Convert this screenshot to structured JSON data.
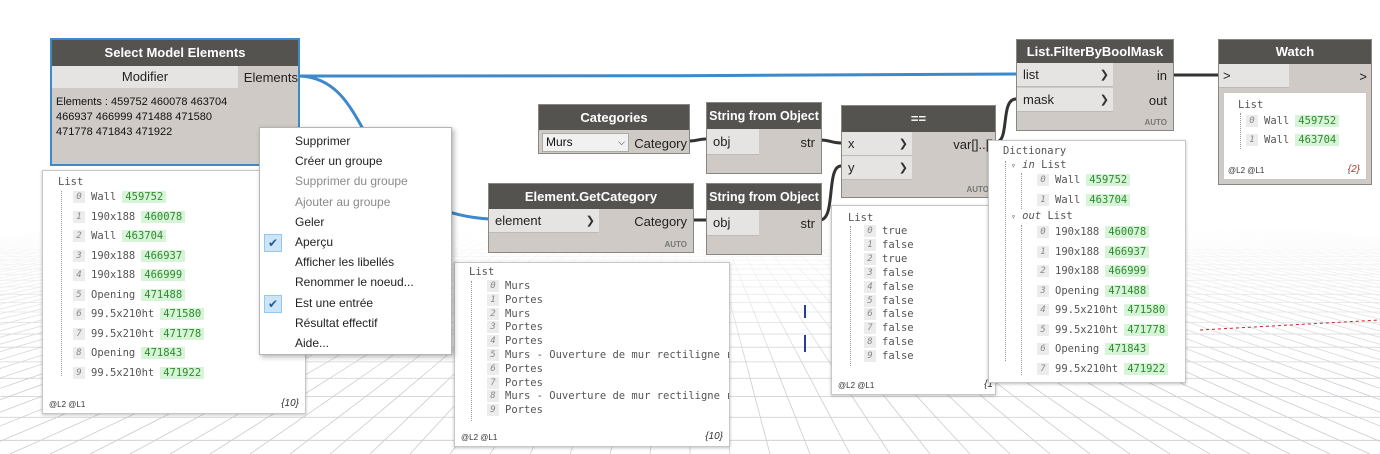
{
  "nodes": {
    "select": {
      "title": "Select Model Elements",
      "button": "Modifier",
      "out_port": "Elements",
      "info": [
        "Elements : 459752 460078 463704",
        "466937 466999 471488 471580",
        "471778 471843 471922"
      ]
    },
    "categories": {
      "title": "Categories",
      "dropdown_value": "Murs",
      "out_port": "Category"
    },
    "str1": {
      "title": "String from Object",
      "in_port": "obj",
      "out_port": "str"
    },
    "str2": {
      "title": "String from Object",
      "in_port": "obj",
      "out_port": "str"
    },
    "getcat": {
      "title": "Element.GetCategory",
      "in_port": "element",
      "out_port": "Category",
      "auto": "AUTO"
    },
    "eq": {
      "title": "==",
      "in_x": "x",
      "in_y": "y",
      "out_port": "var[]..[]",
      "auto": "AUTO"
    },
    "filter": {
      "title": "List.FilterByBoolMask",
      "in_list": "list",
      "in_mask": "mask",
      "out_in": "in",
      "out_out": "out",
      "auto": "AUTO"
    },
    "watch": {
      "title": "Watch",
      "in_port": ">",
      "out_port": ">"
    }
  },
  "previews": {
    "p1": {
      "header": "List",
      "items": [
        {
          "i": "0",
          "t": "Wall",
          "g": "459752"
        },
        {
          "i": "1",
          "t": "190x188",
          "g": "460078"
        },
        {
          "i": "2",
          "t": "Wall",
          "g": "463704"
        },
        {
          "i": "3",
          "t": "190x188",
          "g": "466937"
        },
        {
          "i": "4",
          "t": "190x188",
          "g": "466999"
        },
        {
          "i": "5",
          "t": "Opening",
          "g": "471488"
        },
        {
          "i": "6",
          "t": "99.5x210ht",
          "g": "471580"
        },
        {
          "i": "7",
          "t": "99.5x210ht",
          "g": "471778"
        },
        {
          "i": "8",
          "t": "Opening",
          "g": "471843"
        },
        {
          "i": "9",
          "t": "99.5x210ht",
          "g": "471922"
        }
      ],
      "levels": "@L2 @L1",
      "count": "{10}"
    },
    "p2": {
      "header": "List",
      "items": [
        {
          "i": "0",
          "t": "Murs"
        },
        {
          "i": "1",
          "t": "Portes"
        },
        {
          "i": "2",
          "t": "Murs"
        },
        {
          "i": "3",
          "t": "Portes"
        },
        {
          "i": "4",
          "t": "Portes"
        },
        {
          "i": "5",
          "t": "Murs - Ouverture de mur rectiligne re"
        },
        {
          "i": "6",
          "t": "Portes"
        },
        {
          "i": "7",
          "t": "Portes"
        },
        {
          "i": "8",
          "t": "Murs - Ouverture de mur rectiligne re"
        },
        {
          "i": "9",
          "t": "Portes"
        }
      ],
      "levels": "@L2 @L1",
      "count": "{10}"
    },
    "p3": {
      "header": "List",
      "items": [
        {
          "i": "0",
          "t": "true"
        },
        {
          "i": "1",
          "t": "false"
        },
        {
          "i": "2",
          "t": "true"
        },
        {
          "i": "3",
          "t": "false"
        },
        {
          "i": "4",
          "t": "false"
        },
        {
          "i": "5",
          "t": "false"
        },
        {
          "i": "6",
          "t": "false"
        },
        {
          "i": "7",
          "t": "false"
        },
        {
          "i": "8",
          "t": "false"
        },
        {
          "i": "9",
          "t": "false"
        }
      ],
      "levels": "@L2 @L1",
      "count": "{1"
    },
    "p4": {
      "header": "Dictionary",
      "in_label": "in",
      "in_list": "List",
      "out_label": "out",
      "out_list": "List",
      "in_items": [
        {
          "i": "0",
          "t": "Wall",
          "g": "459752"
        },
        {
          "i": "1",
          "t": "Wall",
          "g": "463704"
        }
      ],
      "out_items": [
        {
          "i": "0",
          "t": "190x188",
          "g": "460078"
        },
        {
          "i": "1",
          "t": "190x188",
          "g": "466937"
        },
        {
          "i": "2",
          "t": "190x188",
          "g": "466999"
        },
        {
          "i": "3",
          "t": "Opening",
          "g": "471488"
        },
        {
          "i": "4",
          "t": "99.5x210ht",
          "g": "471580"
        },
        {
          "i": "5",
          "t": "99.5x210ht",
          "g": "471778"
        },
        {
          "i": "6",
          "t": "Opening",
          "g": "471843"
        },
        {
          "i": "7",
          "t": "99.5x210ht",
          "g": "471922"
        }
      ]
    },
    "p5": {
      "header": "List",
      "items": [
        {
          "i": "0",
          "t": "Wall",
          "g": "459752"
        },
        {
          "i": "1",
          "t": "Wall",
          "g": "463704"
        }
      ],
      "levels": "@L2 @L1",
      "count": "{2}"
    }
  },
  "context_menu": [
    {
      "label": "Supprimer",
      "state": "normal"
    },
    {
      "label": "Créer un groupe",
      "state": "normal"
    },
    {
      "label": "Supprimer du groupe",
      "state": "disabled"
    },
    {
      "label": "Ajouter au groupe",
      "state": "disabled"
    },
    {
      "label": "Geler",
      "state": "normal"
    },
    {
      "label": "Aperçu",
      "state": "checked"
    },
    {
      "label": "Afficher les libellés",
      "state": "normal"
    },
    {
      "label": "Renommer le noeud...",
      "state": "normal"
    },
    {
      "label": "Est une entrée",
      "state": "checked"
    },
    {
      "label": "Résultat effectif",
      "state": "normal"
    },
    {
      "label": "Aide...",
      "state": "normal"
    }
  ],
  "colors": {
    "wire": "#3d89c9",
    "wire_dark": "#333333",
    "node_header": "#555350",
    "node_body": "#cfcac5",
    "green_value": "#d8f4d8",
    "grid": "#c9ccd0"
  }
}
